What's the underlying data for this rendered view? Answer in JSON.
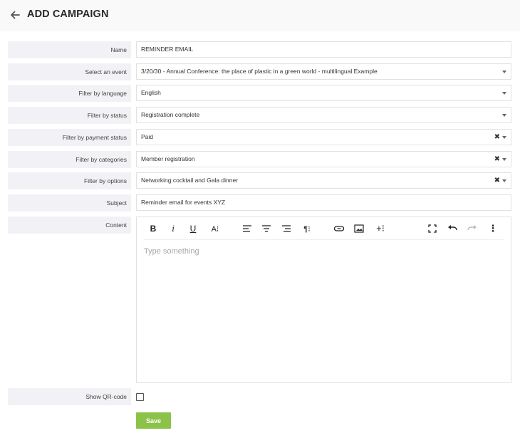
{
  "header": {
    "title": "ADD CAMPAIGN",
    "back_icon": "arrow-left-icon"
  },
  "form": {
    "name": {
      "label": "Name",
      "value": "REMINDER EMAIL"
    },
    "event": {
      "label": "Select an event",
      "value": "3/20/30 - Annual Conference: the place of plastic in a green world - multilingual Example"
    },
    "language": {
      "label": "Filter by language",
      "value": "English"
    },
    "status": {
      "label": "Filter by status",
      "value": "Registration complete"
    },
    "payment_status": {
      "label": "Filter by payment status",
      "value": "Paid",
      "clear": "✖"
    },
    "categories": {
      "label": "Filter by categories",
      "value": "Member registration",
      "clear": "✖"
    },
    "options": {
      "label": "Filter by options",
      "value": "Networking cocktail and Gala dinner",
      "clear": "✖"
    },
    "subject": {
      "label": "Subject",
      "value": "Reminder email for events XYZ"
    },
    "content": {
      "label": "Content",
      "placeholder": "Type something",
      "toolbar": {
        "bold": "B",
        "italic": "i",
        "underline": "U",
        "font_size": "A⁝",
        "paragraph": "¶⁝",
        "insert": "+⁝",
        "more": "⋮"
      }
    },
    "show_qr": {
      "label": "Show QR-code",
      "checked": false
    },
    "save_label": "Save"
  }
}
